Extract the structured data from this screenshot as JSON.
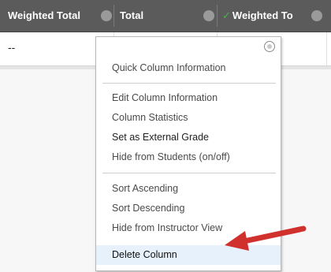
{
  "header": {
    "weighted_total": "Weighted Total",
    "total": "Total",
    "weighted_total_truncated": "Weighted To"
  },
  "row": {
    "weighted_total_value": "--"
  },
  "menu": {
    "groups": [
      [
        "Quick Column Information"
      ],
      [
        "Edit Column Information",
        "Column Statistics",
        "Set as External Grade",
        "Hide from Students (on/off)"
      ],
      [
        "Sort Ascending",
        "Sort Descending",
        "Hide from Instructor View",
        "Delete Column"
      ]
    ]
  },
  "colors": {
    "arrow": "#d0312d",
    "header_bg": "#5b5b5b",
    "check": "#4caf50",
    "highlight": "#e6f1fb"
  },
  "icons": [
    "column-menu-icon",
    "checkmark-icon",
    "close-icon",
    "pointer-arrow-icon"
  ]
}
